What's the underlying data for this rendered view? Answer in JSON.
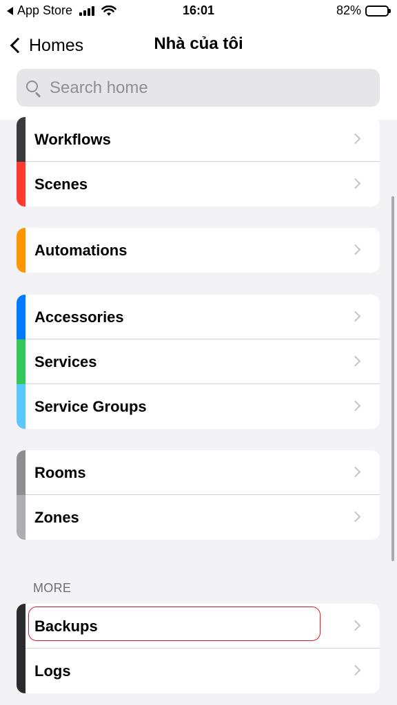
{
  "status_bar": {
    "back_app": "App Store",
    "time": "16:01",
    "battery_percent": "82%",
    "battery_level": 0.82
  },
  "nav": {
    "back_label": "Homes",
    "title": "Nhà của tôi"
  },
  "search": {
    "placeholder": "Search home",
    "value": ""
  },
  "groups": [
    {
      "rows": [
        {
          "label": "Workflows",
          "accent": "#3a3a3c"
        },
        {
          "label": "Scenes",
          "accent": "#ff3b30"
        }
      ]
    },
    {
      "rows": [
        {
          "label": "Automations",
          "accent": "#ff9500"
        }
      ]
    },
    {
      "rows": [
        {
          "label": "Accessories",
          "accent": "#007aff"
        },
        {
          "label": "Services",
          "accent": "#34c759"
        },
        {
          "label": "Service Groups",
          "accent": "#5ac8fa"
        }
      ]
    },
    {
      "rows": [
        {
          "label": "Rooms",
          "accent": "#8e8e93"
        },
        {
          "label": "Zones",
          "accent": "#aeaeb2"
        }
      ]
    }
  ],
  "more": {
    "header": "MORE",
    "rows": [
      {
        "label": "Backups",
        "accent": "#2c2c2e"
      },
      {
        "label": "Logs",
        "accent": "#2c2c2e"
      }
    ]
  }
}
